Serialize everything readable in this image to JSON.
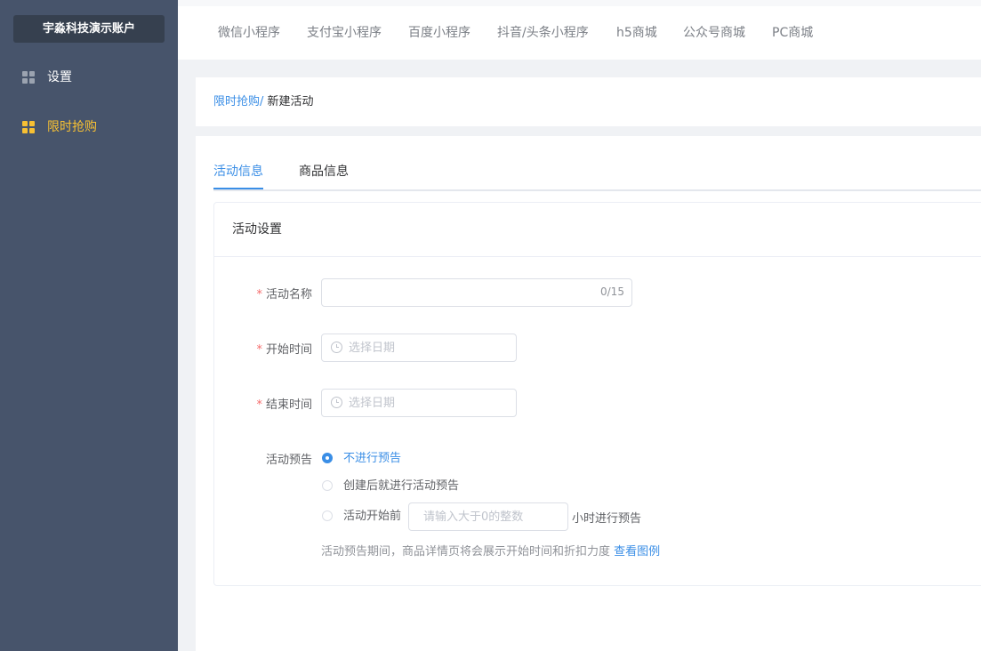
{
  "sidebar": {
    "account": "宇淼科技演示账户",
    "items": [
      {
        "label": "设置",
        "icon": "grid-icon",
        "active": false
      },
      {
        "label": "限时抢购",
        "icon": "grid-icon",
        "active": true
      }
    ]
  },
  "topnav": {
    "tabs": [
      "微信小程序",
      "支付宝小程序",
      "百度小程序",
      "抖音/头条小程序",
      "h5商城",
      "公众号商城",
      "PC商城"
    ]
  },
  "breadcrumb": {
    "parent": "限时抢购/",
    "current": "新建活动"
  },
  "tabs": {
    "items": [
      "活动信息",
      "商品信息"
    ],
    "active": "活动信息"
  },
  "form": {
    "section_title": "活动设置",
    "required_mark": "*",
    "name": {
      "label": "活动名称",
      "value": "",
      "counter": "0/15"
    },
    "start": {
      "label": "开始时间",
      "placeholder": "选择日期"
    },
    "end": {
      "label": "结束时间",
      "placeholder": "选择日期"
    },
    "preview": {
      "label": "活动预告",
      "options": [
        "不进行预告",
        "创建后就进行活动预告",
        "活动开始前"
      ],
      "selected": "不进行预告",
      "hours_placeholder": "请输入大于0的整数",
      "hours_suffix": "小时进行预告",
      "hint": "活动预告期间，商品详情页将会展示开始时间和折扣力度",
      "hint_link": "查看图例"
    }
  },
  "colors": {
    "sidebar_bg": "#47546b",
    "accent": "#3a8ee6",
    "active_nav": "#f7c033",
    "required": "#f56c6c"
  }
}
